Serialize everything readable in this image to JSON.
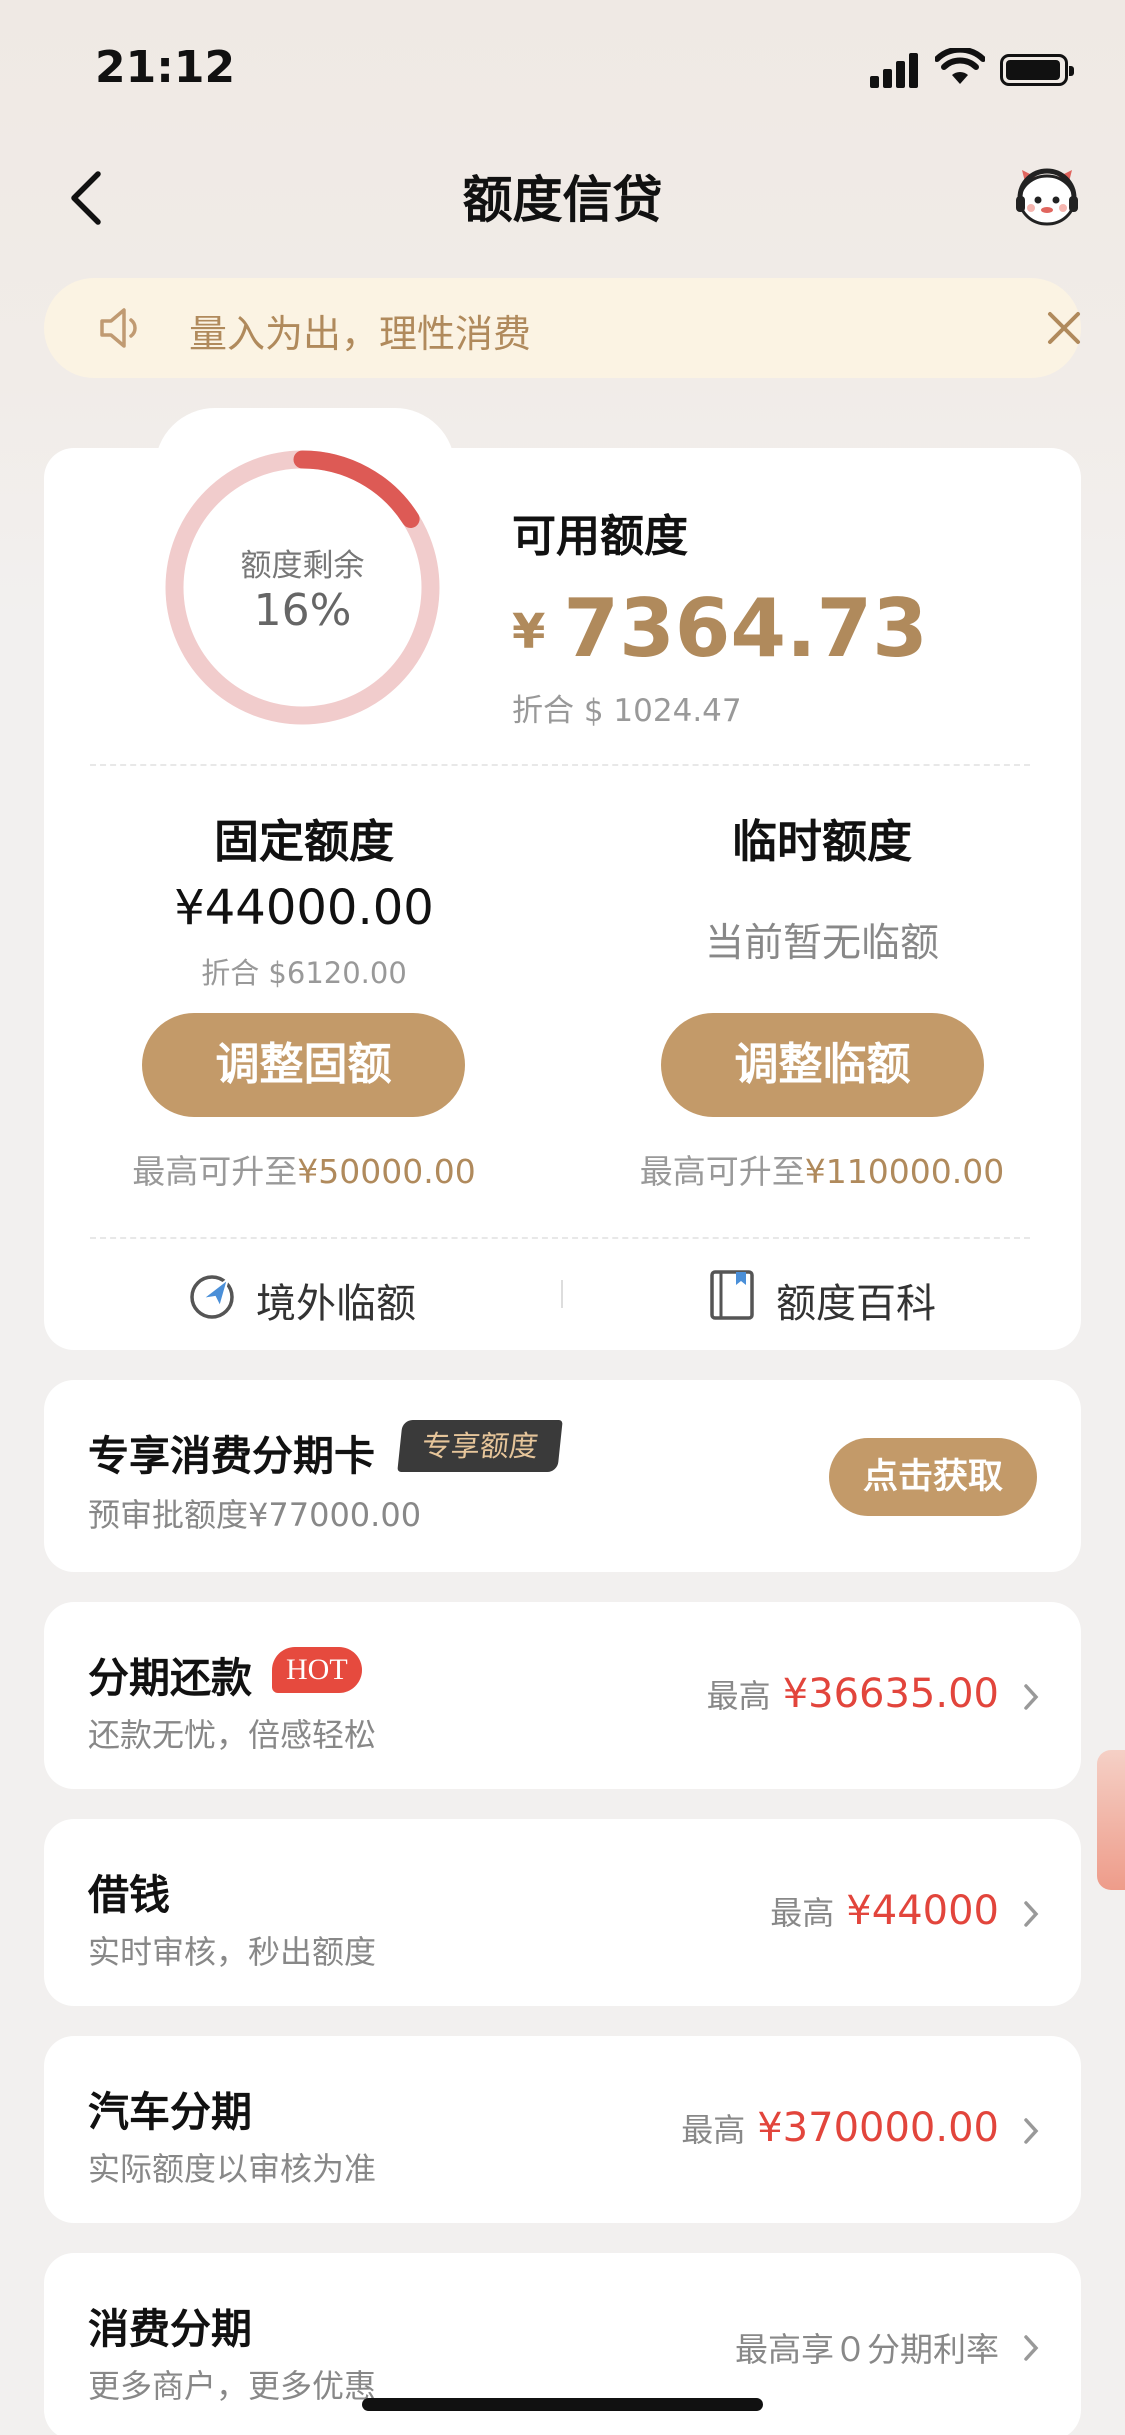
{
  "status": {
    "time": "21:12"
  },
  "nav": {
    "title": "额度信贷"
  },
  "notice": {
    "text": "量入为出，理性消费"
  },
  "quota": {
    "ring_label": "额度剩余",
    "ring_percent": "16%",
    "ring_fraction": 0.16,
    "available_label": "可用额度",
    "available_currency": "¥",
    "available_amount": "7364.73",
    "available_usd": "折合 $ 1024.47",
    "fixed_title": "固定额度",
    "fixed_amount": "¥44000.00",
    "fixed_usd": "折合 $6120.00",
    "fixed_button": "调整固额",
    "fixed_upto_prefix": "最高可升至",
    "fixed_upto_value": "¥50000.00",
    "temp_title": "临时额度",
    "temp_none": "当前暂无临额",
    "temp_button": "调整临额",
    "temp_upto_prefix": "最高可升至",
    "temp_upto_value": "¥110000.00",
    "link_overseas": "境外临额",
    "link_wiki": "额度百科"
  },
  "exclusive": {
    "title": "专享消费分期卡",
    "badge": "专享额度",
    "subtitle": "预审批额度¥77000.00",
    "button": "点击获取"
  },
  "products": [
    {
      "title": "分期还款",
      "badge": "HOT",
      "subtitle": "还款无忧，倍感轻松",
      "prefix": "最高",
      "value": "¥36635.00"
    },
    {
      "title": "借钱",
      "subtitle": "实时审核，秒出额度",
      "prefix": "最高",
      "value": "¥44000"
    },
    {
      "title": "汽车分期",
      "subtitle": "实际额度以审核为准",
      "prefix": "最高",
      "value": "¥370000.00"
    },
    {
      "title": "消费分期",
      "subtitle": "更多商户，更多优惠",
      "plain": "最高享０分期利率"
    }
  ],
  "colors": {
    "gold": "#c39a69",
    "gold_text": "#b08a5c",
    "red": "#e2453c",
    "ring_track": "#f1cccc",
    "ring_fill": "#dd5a55"
  }
}
